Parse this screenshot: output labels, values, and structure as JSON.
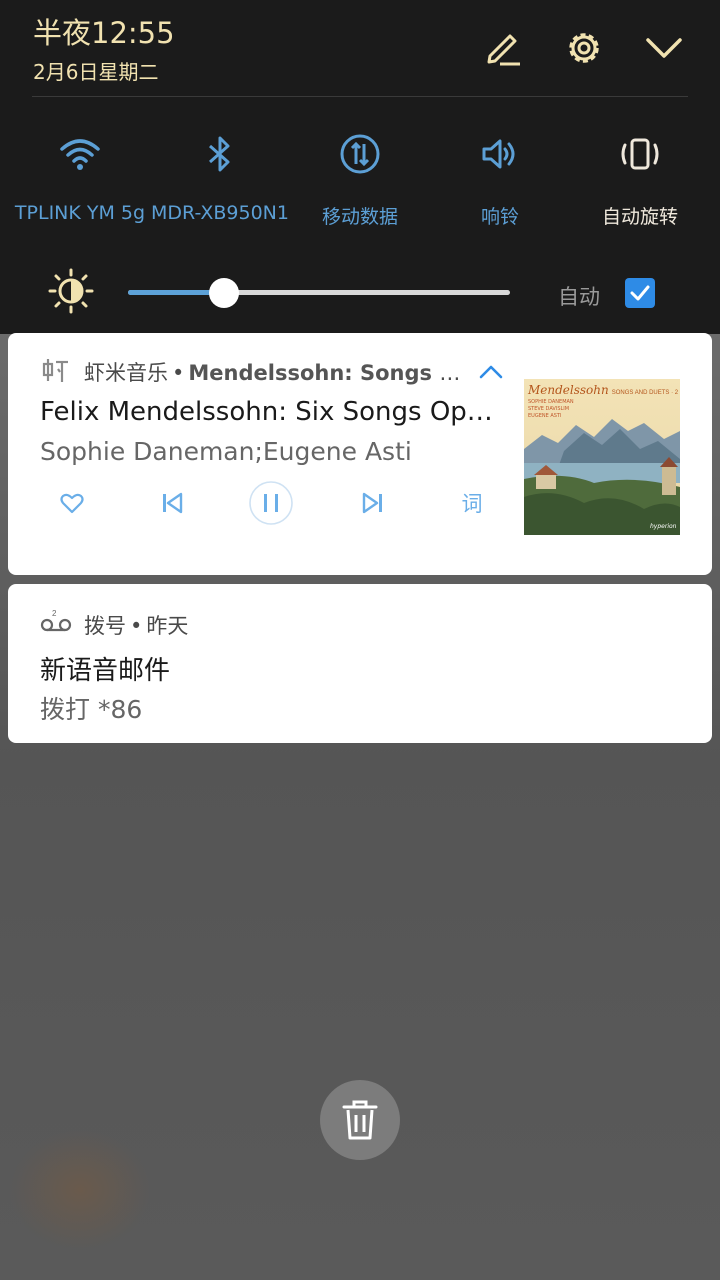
{
  "status": {
    "time": "半夜12:55",
    "date": "2月6日星期二"
  },
  "header_icons": [
    "edit-icon",
    "settings-icon",
    "collapse-chevron-icon"
  ],
  "quick_settings": {
    "tiles": [
      {
        "label": "TPLINK YM 5g",
        "icon": "wifi-icon",
        "active": true
      },
      {
        "label": "MDR-XB950N1",
        "icon": "bluetooth-icon",
        "active": true
      },
      {
        "label": "移动数据",
        "icon": "mobile-data-icon",
        "active": true
      },
      {
        "label": "响铃",
        "icon": "ring-volume-icon",
        "active": true
      },
      {
        "label": "自动旋转",
        "icon": "auto-rotate-icon",
        "active": false
      }
    ]
  },
  "brightness": {
    "level": 0.25,
    "auto_label": "自动",
    "auto_checked": true
  },
  "notifications": {
    "music": {
      "app_name": "虾米音乐",
      "separator": "•",
      "header_title": "Mendelssohn: Songs a…",
      "song_title": "Felix Mendelssohn: Six Songs Op.3…",
      "artist": "Sophie Daneman;Eugene Asti",
      "lyrics_label": "词",
      "album_art": {
        "title": "Mendelssohn",
        "subtitle": "SONGS AND DUETS · 2",
        "credits": [
          "SOPHIE DANEMAN",
          "STEVE DAVISLIM",
          "EUGENE ASTI"
        ],
        "publisher": "hyperion"
      }
    },
    "voicemail": {
      "app_name": "拨号",
      "separator": "•",
      "time": "昨天",
      "title": "新语音邮件",
      "text": "拨打 *86"
    }
  },
  "colors": {
    "accent": "#5c9fd5",
    "header_text": "#f1e2b0",
    "shade_bg": "#1b1b1b"
  }
}
